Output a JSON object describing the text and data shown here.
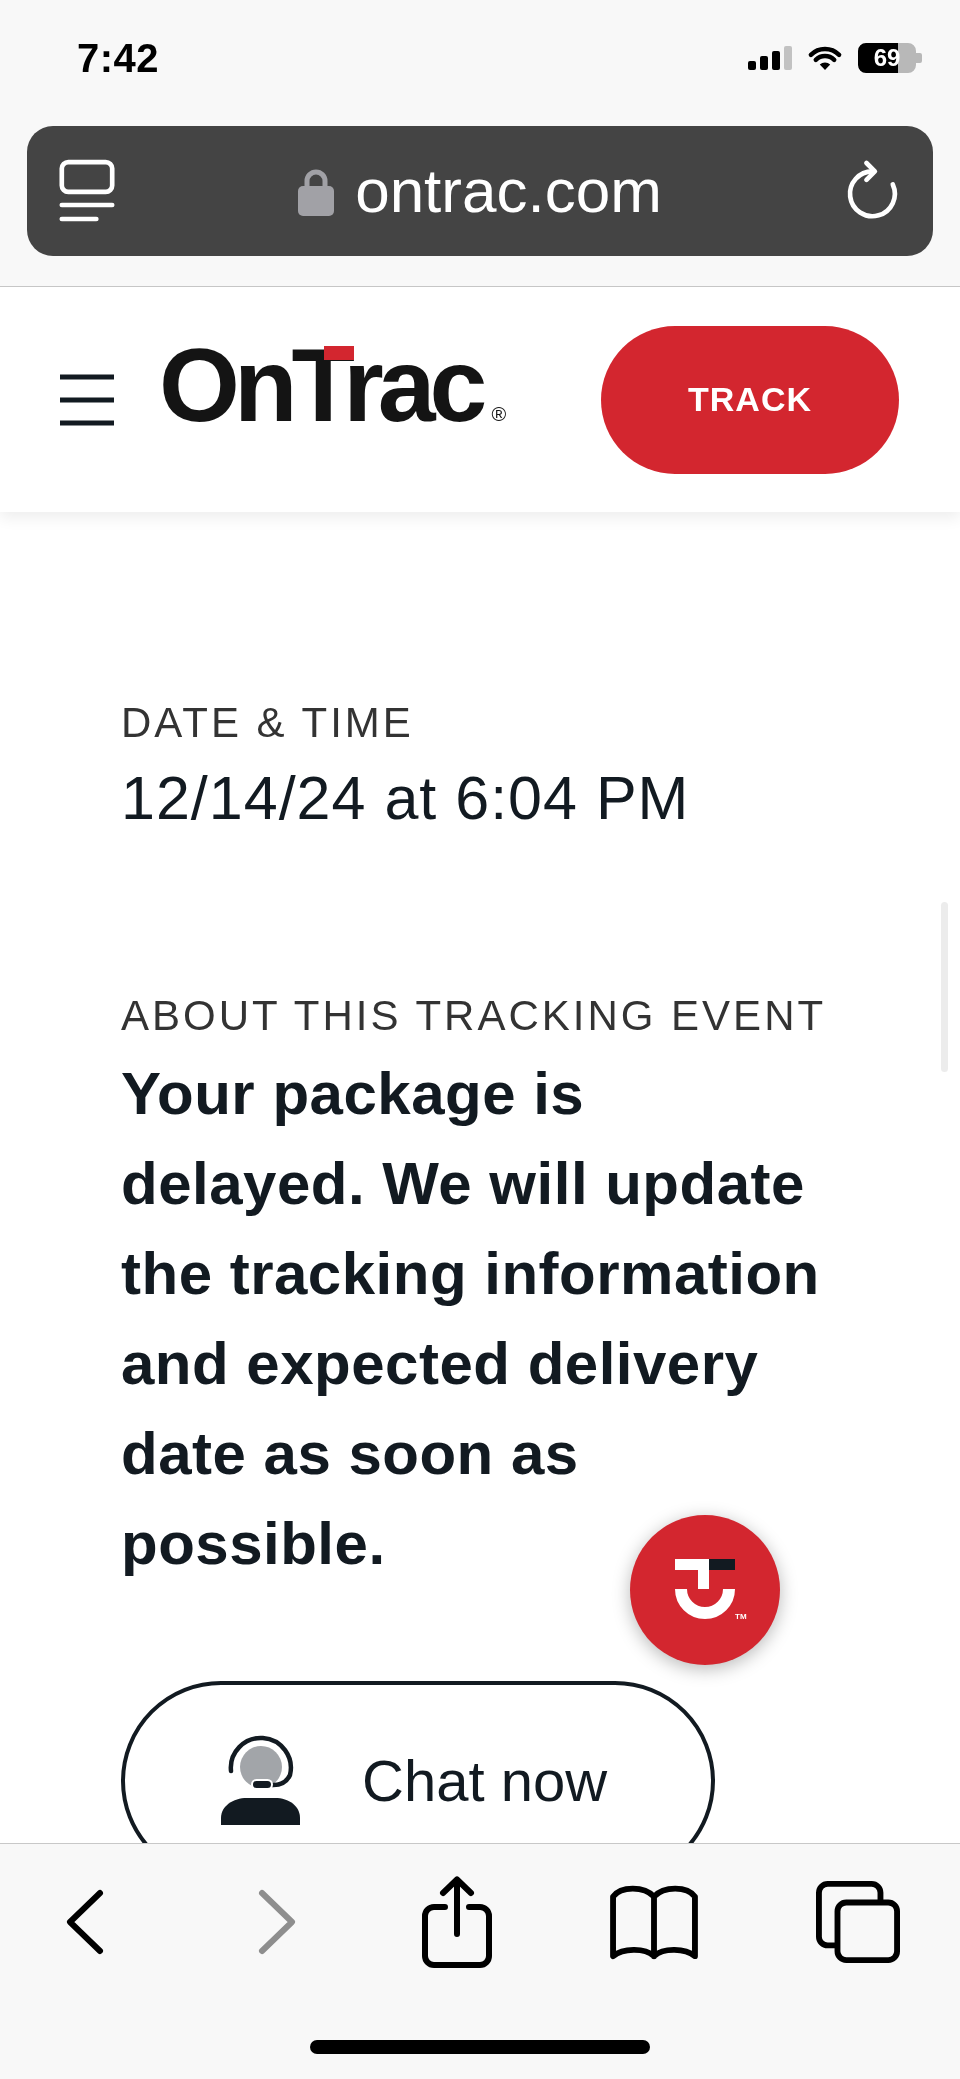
{
  "status_bar": {
    "time": "7:42",
    "battery": "69"
  },
  "address_bar": {
    "url": "ontrac.com"
  },
  "header": {
    "logo": "OnTrac$_{®}$",
    "button": "TRACK"
  },
  "date_time": {
    "label": "DATE & TIME",
    "value": "12/14/24 at 6:04 PM"
  },
  "event": {
    "label": "ABOUT THIS TRACKING EVENT",
    "text": "Your package is delayed. We will update the tracking information and expected delivery date as soon as possible."
  },
  "chat_bubble": {
    "trademark": "TM"
  },
  "chat_button": {
    "label": "Chat now"
  },
  "toolbar": {
    "items": [
      {
        "kind": "back",
        "disabled": false
      },
      {
        "kind": "forward",
        "disabled": true
      },
      {
        "kind": "share",
        "disabled": false
      },
      {
        "kind": "bookmarks",
        "disabled": false
      },
      {
        "kind": "tabs",
        "disabled": false
      }
    ]
  }
}
